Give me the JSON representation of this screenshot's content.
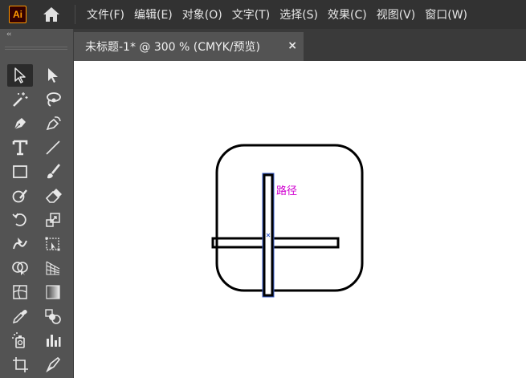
{
  "app": {
    "logo_text": "Ai"
  },
  "menu": {
    "items": [
      "文件(F)",
      "编辑(E)",
      "对象(O)",
      "文字(T)",
      "选择(S)",
      "效果(C)",
      "视图(V)",
      "窗口(W)"
    ]
  },
  "document": {
    "tab_title": "未标题-1* @ 300 % (CMYK/预览)",
    "close_glyph": "×"
  },
  "canvas": {
    "hover_label": "路径",
    "label_color": "#d000d0",
    "selection_color": "#3b5fcf"
  },
  "toolbar": {
    "collapse_glyph": "‹‹",
    "tools": [
      "selection-tool",
      "direct-selection-tool",
      "magic-wand-tool",
      "lasso-tool",
      "pen-tool",
      "curvature-tool",
      "type-tool",
      "line-segment-tool",
      "rectangle-tool",
      "paintbrush-tool",
      "shaper-tool",
      "eraser-tool",
      "rotate-tool",
      "scale-tool",
      "warp-tool",
      "free-transform-tool",
      "shape-builder-tool",
      "perspective-grid-tool",
      "mesh-tool",
      "gradient-tool",
      "eyedropper-tool",
      "blend-tool",
      "symbol-sprayer-tool",
      "column-graph-tool",
      "artboard-tool",
      "slice-tool"
    ]
  }
}
